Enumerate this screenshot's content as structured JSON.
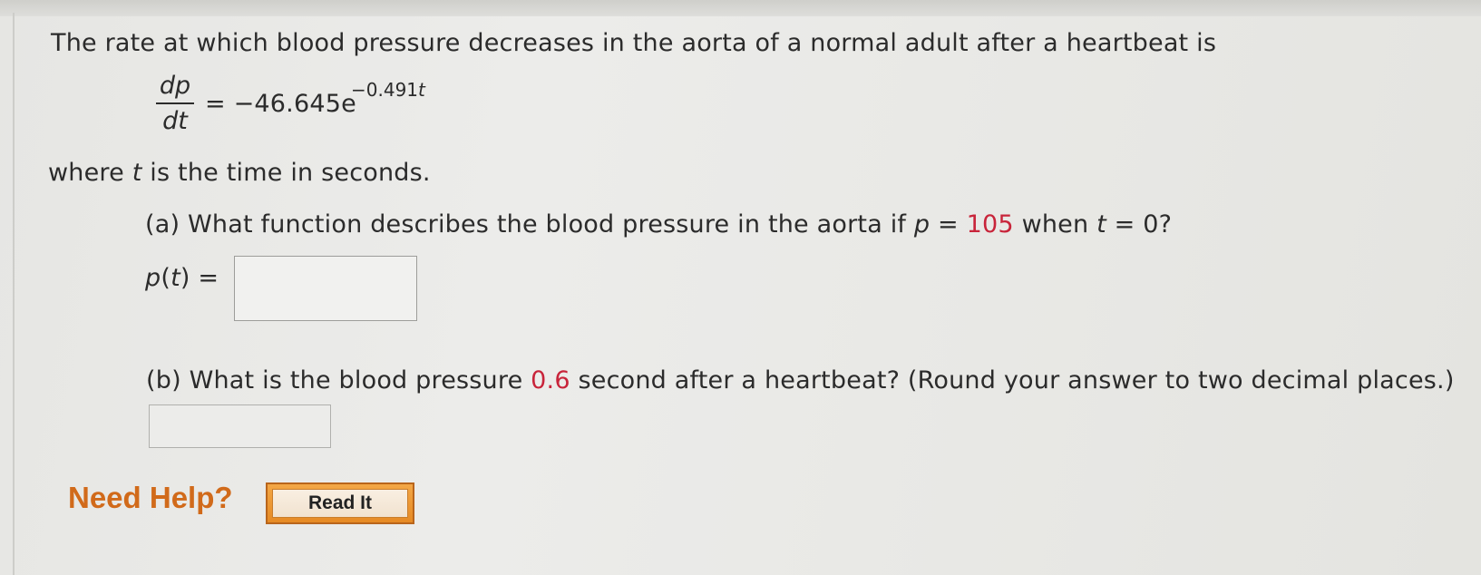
{
  "problem": {
    "intro": "The rate at which blood pressure decreases in the aorta of a normal adult after a heartbeat is",
    "equation": {
      "numerator": "dp",
      "denominator": "dt",
      "rhs": "= −46.645e",
      "exponent_coefficient": "−0.491",
      "exponent_variable": "t"
    },
    "where_prefix": "where ",
    "where_var": "t",
    "where_suffix": " is the time in seconds."
  },
  "part_a": {
    "q_prefix": "(a) What function describes the blood pressure in the aorta if ",
    "var_p": "p",
    "eq1": " = ",
    "p_value": "105",
    "q_mid": " when ",
    "var_t": "t",
    "q_suffix": " = 0?",
    "label_p": "p",
    "label_open": "(",
    "label_t": "t",
    "label_close": ") =",
    "answer_value": ""
  },
  "part_b": {
    "q_prefix": "(b) What is the blood pressure ",
    "time_value": "0.6",
    "q_suffix": " second after a heartbeat? (Round your answer to two decimal places.)",
    "answer_value": ""
  },
  "help": {
    "label": "Need Help?",
    "read_it_label": "Read It"
  },
  "colors": {
    "highlight": "#c8243a",
    "need_help": "#d16a1a",
    "button": "#e68a24"
  }
}
